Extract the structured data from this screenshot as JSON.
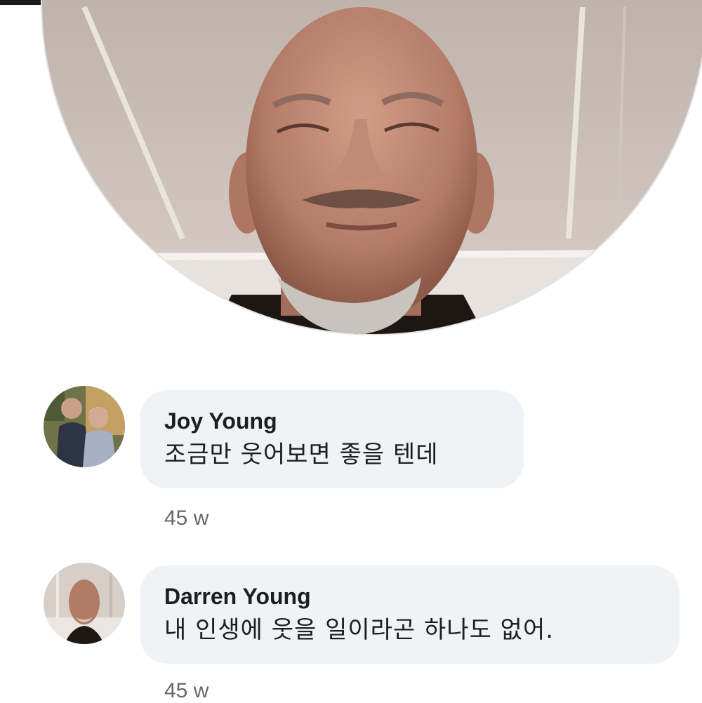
{
  "comments": [
    {
      "author": "Joy Young",
      "text": "조금만 웃어보면 좋을 텐데",
      "time": "45 w",
      "avatar": "couple-photo-avatar"
    },
    {
      "author": "Darren Young",
      "text": "내 인생에 웃을 일이라곤 하나도 없어.",
      "time": "45 w",
      "avatar": "man-portrait-avatar"
    }
  ],
  "colors": {
    "bubble": "#f0f2f5",
    "author_text": "#1c1e21",
    "timestamp": "#65676b"
  }
}
